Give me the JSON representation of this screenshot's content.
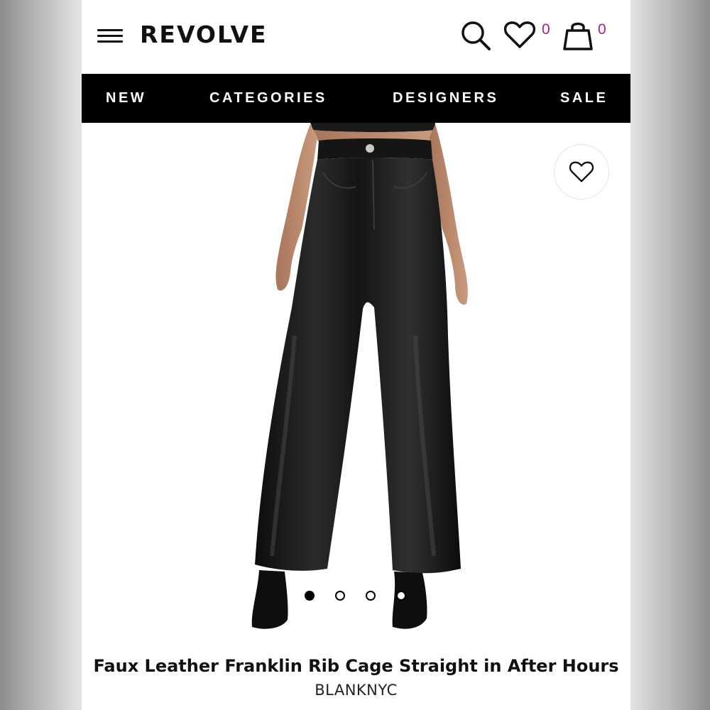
{
  "header": {
    "logo": "REVOLVE",
    "menu_icon": "hamburger-menu-icon",
    "search_icon": "search-icon",
    "wishlist_icon": "heart-icon",
    "wishlist_count": "0",
    "bag_icon": "shopping-bag-icon",
    "bag_count": "0",
    "count_color": "#b11e83"
  },
  "nav": {
    "items": [
      "NEW",
      "CATEGORIES",
      "DESIGNERS",
      "SALE"
    ],
    "background": "#000000"
  },
  "product": {
    "favorite_icon": "heart-outline-icon",
    "carousel": {
      "total": 4,
      "active": 1
    },
    "title": "Faux Leather Franklin Rib Cage Straight in After Hours",
    "brand": "BLANKNYC"
  }
}
